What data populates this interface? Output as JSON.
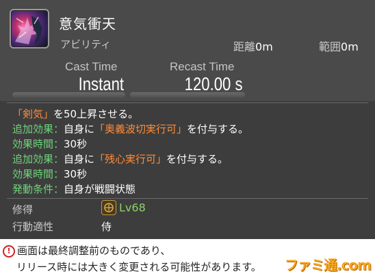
{
  "tooltip": {
    "title": "意気衝天",
    "category": "アビリティ",
    "distance_label": "距離",
    "distance_value": "0m",
    "range_label": "範囲",
    "range_value": "0m",
    "cast_time_label": "Cast Time",
    "cast_time_value": "Instant",
    "recast_time_label": "Recast Time",
    "recast_time_value": "120.00 s",
    "description": {
      "line1_tag": "「剣気」",
      "line1_text": "を50上昇させる。",
      "line2_label": "追加効果：",
      "line2_text_a": "自身に",
      "line2_tag": "「奥義波切実行可」",
      "line2_text_b": "を付与する。",
      "line3_label": "効果時間：",
      "line3_text": "30秒",
      "line4_label": "追加効果：",
      "line4_text_a": "自身に",
      "line4_tag": "「残心実行可」",
      "line4_text_b": "を付与する。",
      "line5_label": "効果時間：",
      "line5_text": "30秒",
      "line6_label": "発動条件：",
      "line6_text": "自身が戦闘状態"
    },
    "acquired_label": "修得",
    "acquired_level": "Lv68",
    "class_label": "行動適性",
    "class_value": "侍"
  },
  "notice": {
    "warning_icon": "!",
    "line1": "画面は最終調整前のものであり、",
    "line2": "リリース時には大きく変更される可能性があります。",
    "logo": "ファミ通.com"
  },
  "colors": {
    "effect_label": "#6fd47a",
    "status_tag": "#ff8c3a",
    "level": "#8fd06a",
    "logo": "#f5a623"
  }
}
